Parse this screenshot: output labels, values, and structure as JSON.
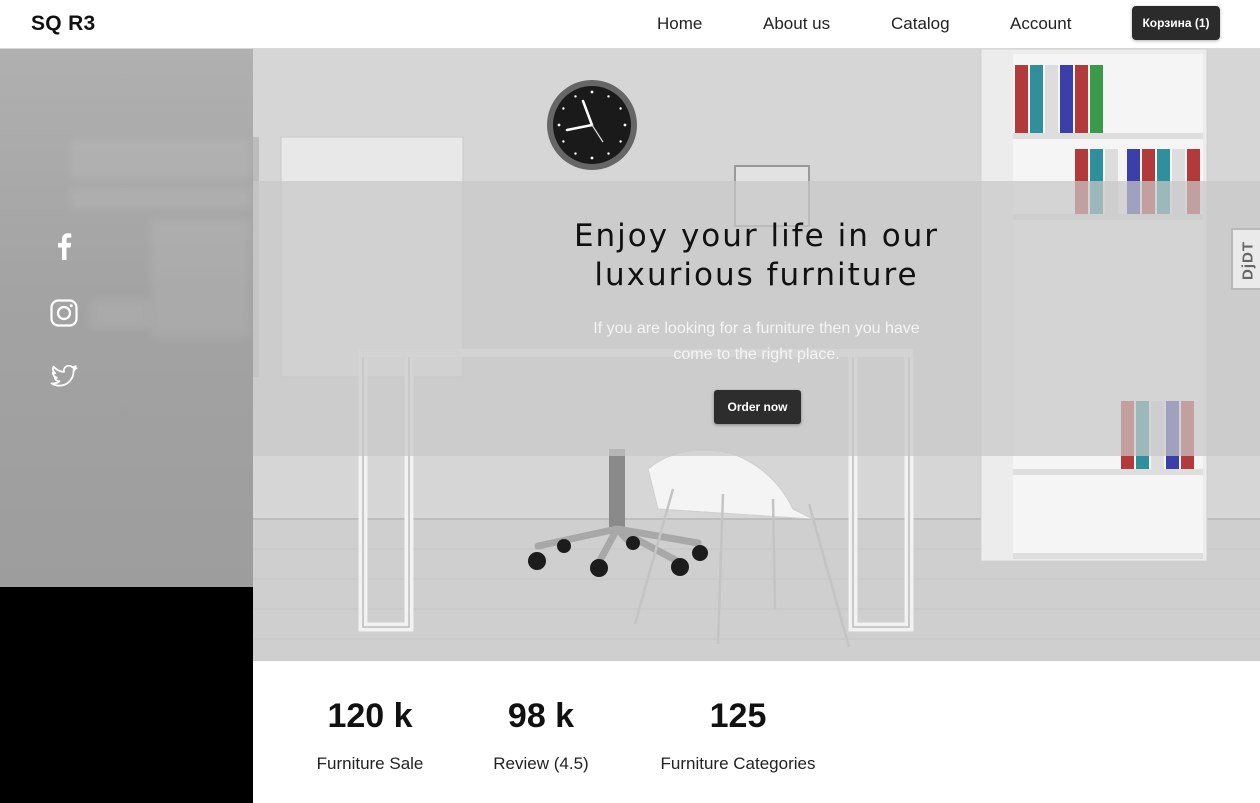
{
  "brand": {
    "logo": "SQ R3"
  },
  "nav": {
    "links": [
      "Home",
      "About us",
      "Catalog",
      "Account"
    ],
    "cart_label": "Корзина (1)"
  },
  "social": {
    "icons": [
      "facebook-icon",
      "instagram-icon",
      "twitter-icon"
    ]
  },
  "hero": {
    "title": "Enjoy your life in our\nluxurious furniture",
    "subtitle": "If you are looking for a furniture then you have\ncome to the right place.",
    "button_label": "Order now",
    "side_badge": "DjDT"
  },
  "stats": [
    {
      "value": "120 k",
      "label": "Furniture Sale"
    },
    {
      "value": "98 k",
      "label": "Review (4.5)"
    },
    {
      "value": "125",
      "label": "Furniture Categories"
    }
  ],
  "colors": {
    "dark_button": "#2b2b2b",
    "overlay": "#c8c8c8",
    "left_panel": "#a5a5a5",
    "left_footer": "#000000"
  }
}
